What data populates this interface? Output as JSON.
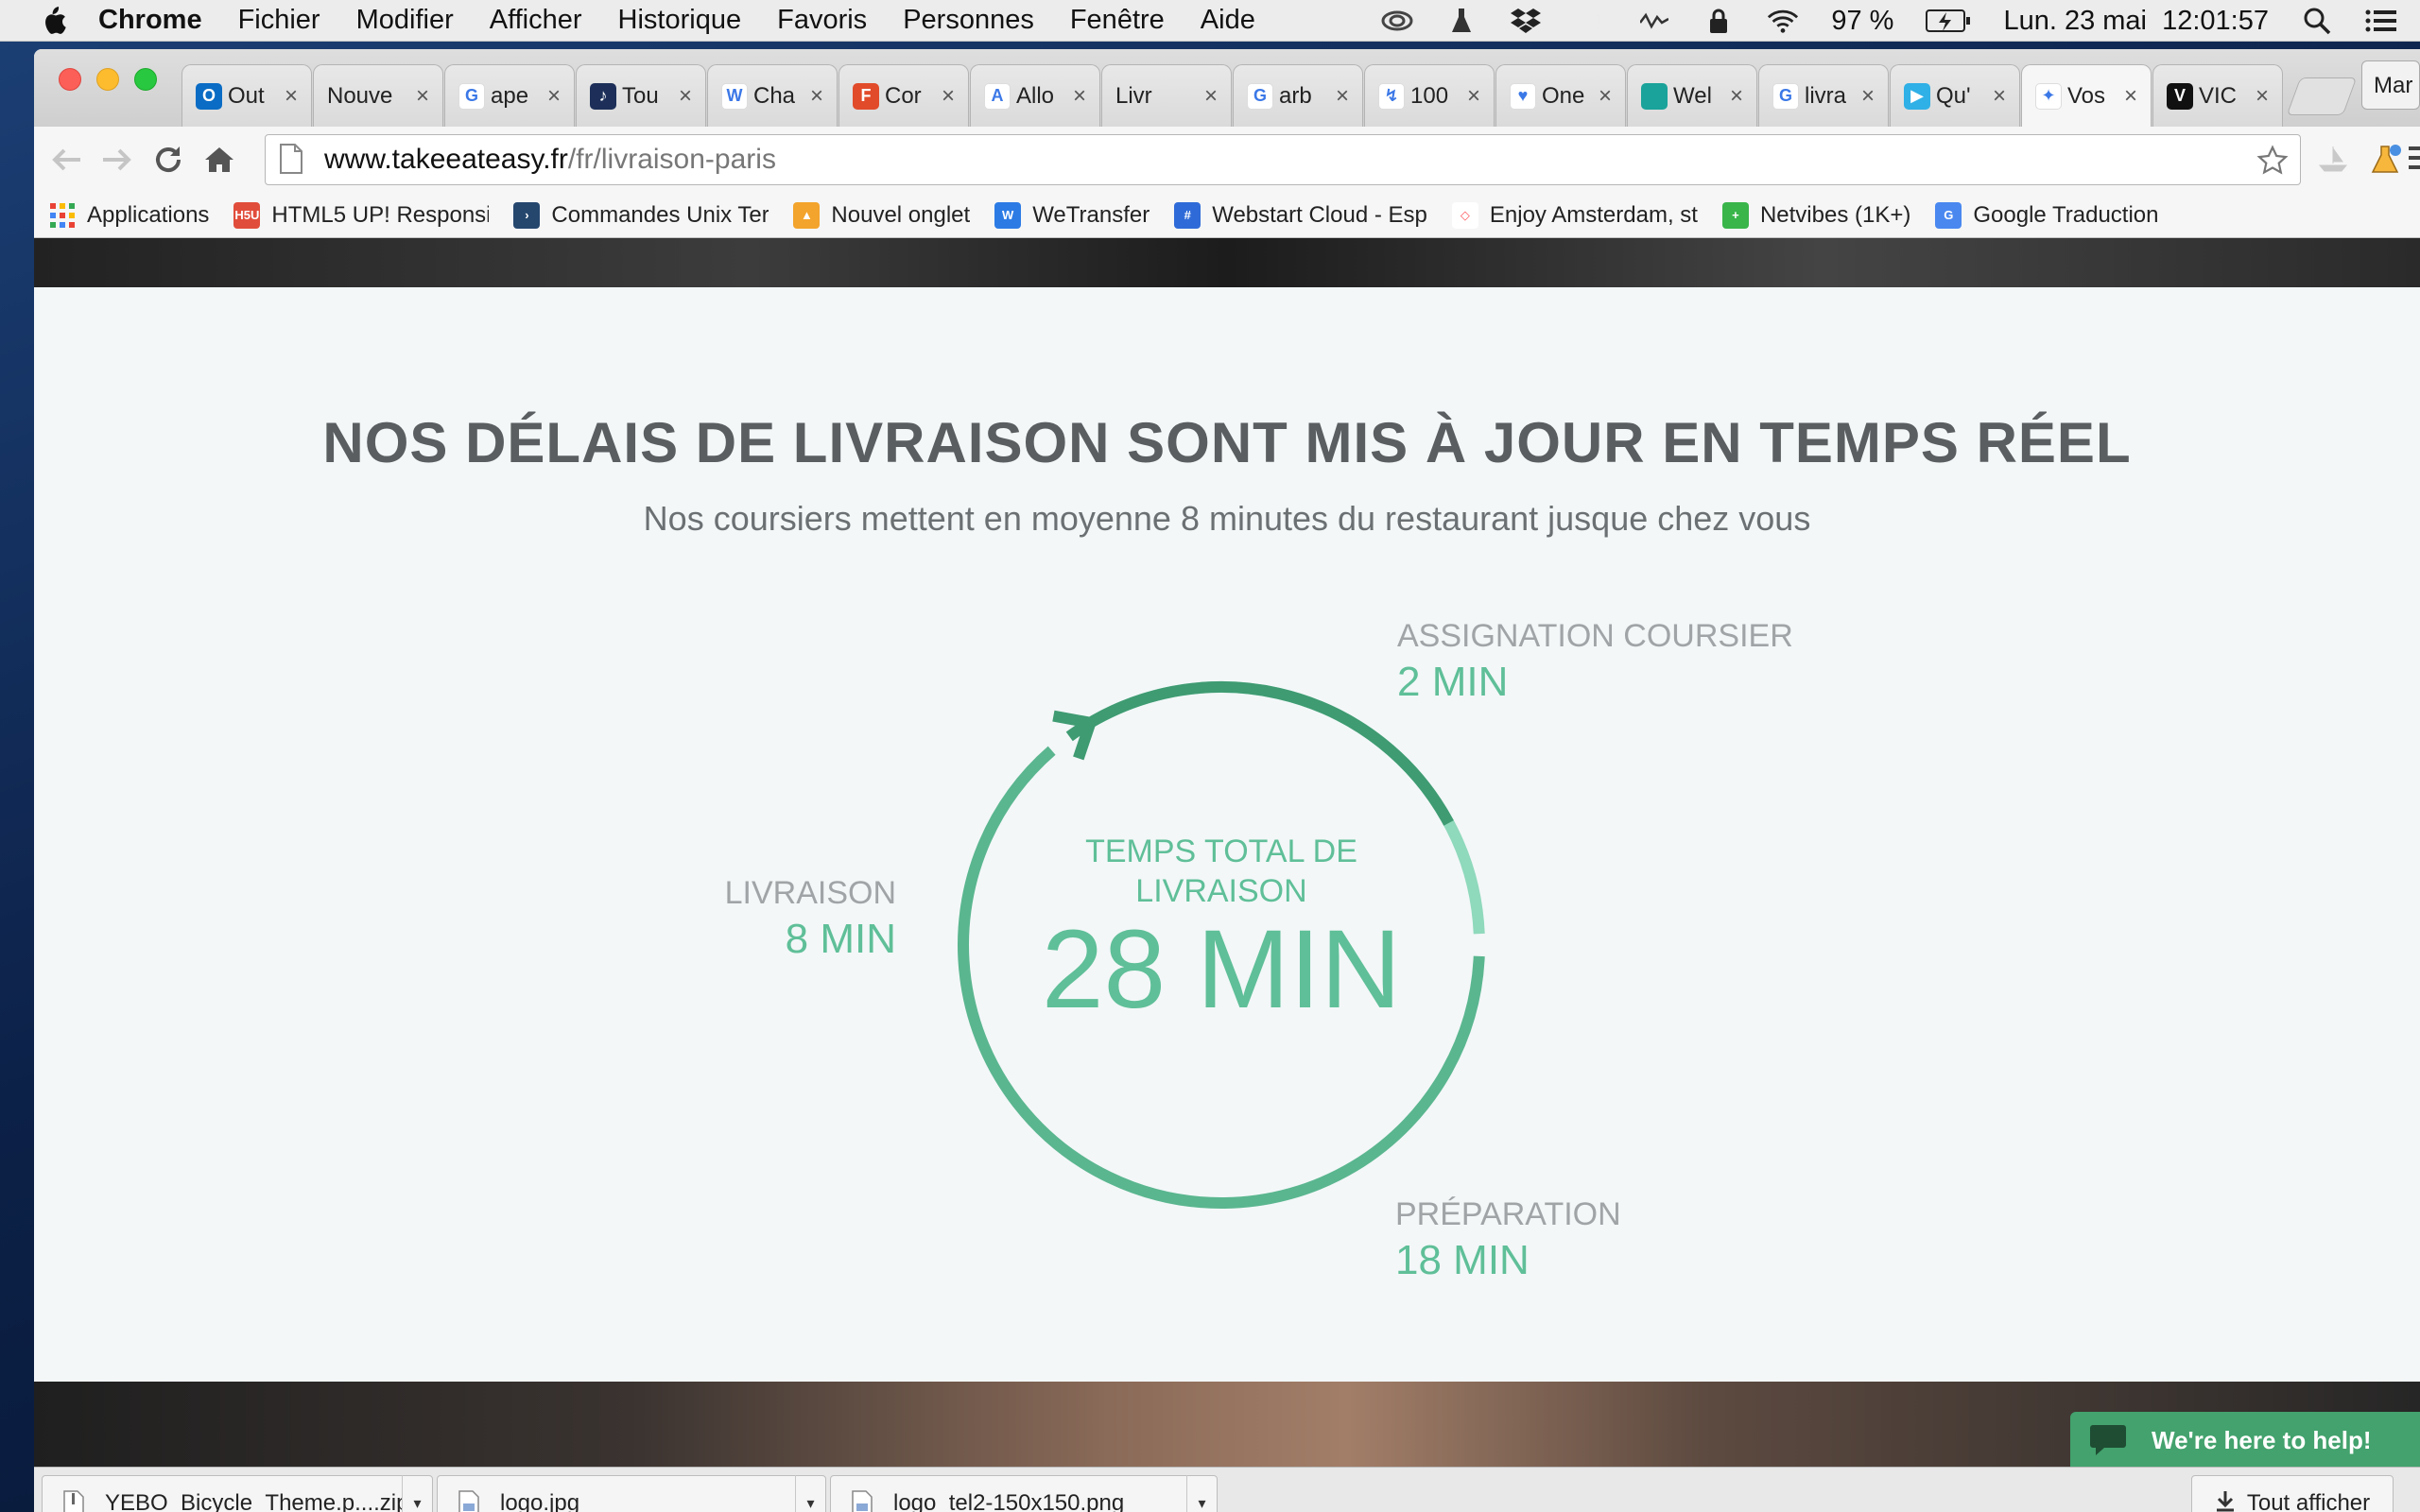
{
  "menubar": {
    "app": "Chrome",
    "items": [
      "Fichier",
      "Modifier",
      "Afficher",
      "Historique",
      "Favoris",
      "Personnes",
      "Fenêtre",
      "Aide"
    ],
    "battery": "97 %",
    "datetime": "Lun. 23 mai  12:01:57"
  },
  "tabs": [
    {
      "label": "Out",
      "icon": "outlook-icon",
      "color": "#0a6cc4",
      "glyph": "O"
    },
    {
      "label": "Nouve",
      "icon": "blank-page-icon",
      "color": "",
      "glyph": ""
    },
    {
      "label": "ape",
      "icon": "google-icon",
      "color": "#ffffff",
      "glyph": "G"
    },
    {
      "label": "Tou",
      "icon": "touch-icon",
      "color": "#1d2f59",
      "glyph": "♪"
    },
    {
      "label": "Cha",
      "icon": "wikipedia-icon",
      "color": "#ffffff",
      "glyph": "W"
    },
    {
      "label": "Cor",
      "icon": "f-logo-icon",
      "color": "#e14b2a",
      "glyph": "F"
    },
    {
      "label": "Allo",
      "icon": "allo-icon",
      "color": "#ffffff",
      "glyph": "A"
    },
    {
      "label": "Livr",
      "icon": "blank-page-icon",
      "color": "",
      "glyph": ""
    },
    {
      "label": "arb",
      "icon": "google-icon",
      "color": "#ffffff",
      "glyph": "G"
    },
    {
      "label": "100",
      "icon": "red-logo-icon",
      "color": "#ffffff",
      "glyph": "↯"
    },
    {
      "label": "One",
      "icon": "heart-icon",
      "color": "#ffffff",
      "glyph": "♥"
    },
    {
      "label": "Wel",
      "icon": "teal-square-icon",
      "color": "#1aa39a",
      "glyph": ""
    },
    {
      "label": "livra",
      "icon": "google-icon",
      "color": "#ffffff",
      "glyph": "G"
    },
    {
      "label": "Qu'",
      "icon": "scooter-icon",
      "color": "#2fb0e6",
      "glyph": "▶"
    },
    {
      "label": "Vos",
      "icon": "wand-icon",
      "color": "#ffffff",
      "glyph": "✦"
    },
    {
      "label": "VIC",
      "icon": "vice-icon",
      "color": "#111111",
      "glyph": "V"
    }
  ],
  "profile": "Mar",
  "omnibox": {
    "domain": "www.takeeateasy.fr",
    "path": "/fr/livraison-paris"
  },
  "bookmarks": [
    {
      "label": "Applications",
      "icon": "apps-grid-icon",
      "color": ""
    },
    {
      "label": "HTML5 UP! Responsi",
      "icon": "html5up-icon",
      "color": "#e14d3b",
      "glyph": "H5U"
    },
    {
      "label": "Commandes Unix Ter",
      "icon": "unix-icon",
      "color": "#25476e",
      "glyph": "›"
    },
    {
      "label": "Nouvel onglet",
      "icon": "ship-icon",
      "color": "#f3a42c",
      "glyph": "▲"
    },
    {
      "label": "WeTransfer",
      "icon": "wetransfer-icon",
      "color": "#2c7be5",
      "glyph": "W"
    },
    {
      "label": "Webstart Cloud - Esp",
      "icon": "hash-icon",
      "color": "#2f6bd8",
      "glyph": "#"
    },
    {
      "label": "Enjoy Amsterdam, st",
      "icon": "airbnb-icon",
      "color": "#ffffff",
      "glyph": "◇"
    },
    {
      "label": "Netvibes (1K+)",
      "icon": "plus-icon",
      "color": "#39b54a",
      "glyph": "+"
    },
    {
      "label": "Google Traduction",
      "icon": "translate-icon",
      "color": "#4a88f0",
      "glyph": "G"
    }
  ],
  "section": {
    "headline": "NOS DÉLAIS DE LIVRAISON SONT MIS À JOUR EN TEMPS RÉEL",
    "subtitle": "Nos coursiers mettent en moyenne 8 minutes du restaurant jusque chez vous",
    "total_label": "TEMPS TOTAL DE LIVRAISON",
    "total_value": "28 MIN",
    "stages": {
      "assign": {
        "label": "ASSIGNATION COURSIER",
        "value": "2 MIN",
        "minutes": 2
      },
      "prep": {
        "label": "PRÉPARATION",
        "value": "18 MIN",
        "minutes": 18
      },
      "delivery": {
        "label": "LIVRAISON",
        "value": "8 MIN",
        "minutes": 8
      }
    },
    "colors": {
      "assign": "#8fd9bc",
      "prep": "#5ab68f",
      "delivery": "#3f9b72",
      "text": "#5fbf98"
    }
  },
  "help_widget": {
    "label": "We're here to help!"
  },
  "downloads": {
    "items": [
      {
        "name": "YEBO_Bicycle_Theme.p....zip"
      },
      {
        "name": "logo.jpg"
      },
      {
        "name": "logo_tel2-150x150.png"
      }
    ],
    "show_all": "Tout afficher"
  }
}
